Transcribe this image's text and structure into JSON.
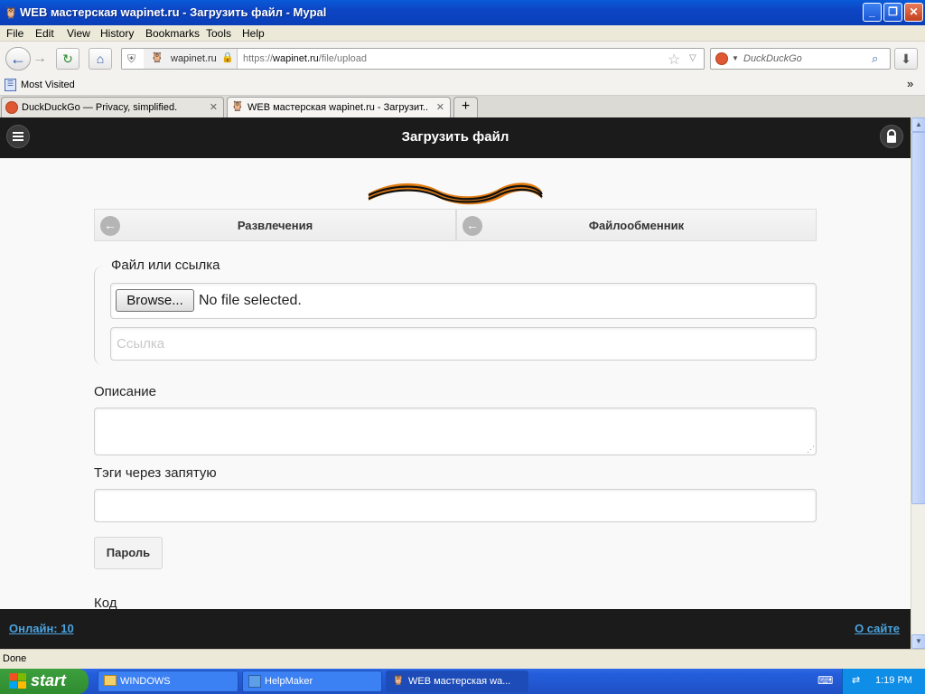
{
  "window": {
    "title": "WEB мастерская wapinet.ru - Загрузить файл - Mypal",
    "minimize_symbol": "_",
    "maximize_symbol": "❐",
    "close_symbol": "✕"
  },
  "menu": {
    "file": "File",
    "edit": "Edit",
    "view": "View",
    "history": "History",
    "bookmarks": "Bookmarks",
    "tools": "Tools",
    "help": "Help"
  },
  "nav": {
    "site_identity": "wapinet.ru",
    "url_prefix": "https://",
    "url_domain": "wapinet.ru",
    "url_path": "/file/upload",
    "search_placeholder": "DuckDuckGo"
  },
  "bookmarks_bar": {
    "most_visited": "Most Visited"
  },
  "tabs": [
    {
      "label": "DuckDuckGo — Privacy, simplified.",
      "close": "✕"
    },
    {
      "label": "WEB мастерская wapinet.ru - Загрузит...",
      "close": "✕"
    }
  ],
  "new_tab_symbol": "+",
  "site": {
    "header_title": "Загрузить файл",
    "crumbs": [
      "Развлечения",
      "Файлообменник"
    ],
    "file_or_link_label": "Файл или ссылка",
    "browse_label": "Browse...",
    "no_file_label": "No file selected.",
    "link_placeholder": "Ссылка",
    "description_label": "Описание",
    "tags_label": "Тэги через запятую",
    "password_button": "Пароль",
    "code_label": "Код",
    "footer_online": "Онлайн: 10",
    "footer_about": "О сайте"
  },
  "statusbar": {
    "text": "Done"
  },
  "taskbar": {
    "start": "start",
    "items": [
      "WINDOWS",
      "HelpMaker",
      "WEB мастерская wa..."
    ],
    "clock": "1:19 PM"
  },
  "colors": {
    "site_header": "#1b1b1b",
    "link": "#4aa3df",
    "xp_title": "#0a5ad8",
    "start_green": "#3d9f3d"
  },
  "icons": [
    "app-owl-icon",
    "back-arrow-icon",
    "forward-arrow-icon",
    "reload-icon",
    "home-icon",
    "shield-icon",
    "lock-icon",
    "star-icon",
    "magnifier-icon",
    "download-icon",
    "hamburger-icon",
    "padlock-icon",
    "ribbon-icon",
    "resize-grip-icon",
    "folder-icon",
    "windows-flag-icon"
  ]
}
